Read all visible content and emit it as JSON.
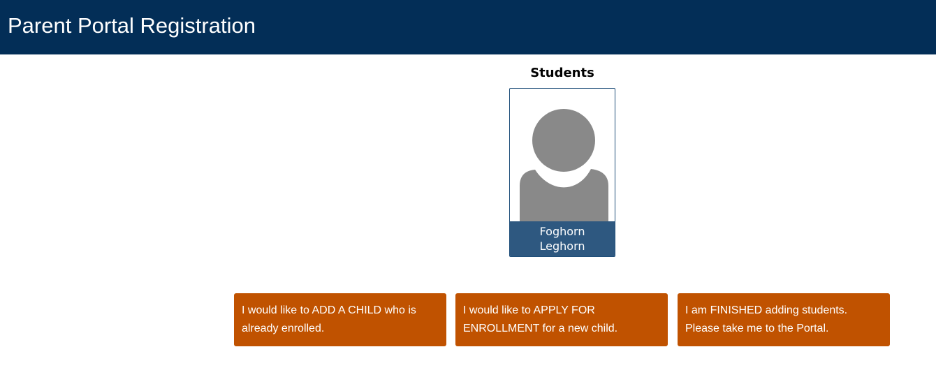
{
  "header": {
    "title": "Parent Portal Registration"
  },
  "students": {
    "heading": "Students",
    "items": [
      {
        "first_name": "Foghorn",
        "last_name": "Leghorn",
        "avatar_icon": "default-person-silhouette-icon"
      }
    ]
  },
  "actions": {
    "add_child": "I would like to ADD A CHILD who is already enrolled.",
    "apply_enrollment": "I would like to APPLY FOR ENROLLMENT for a new child.",
    "finished": "I am FINISHED adding students. Please take me to the Portal."
  },
  "colors": {
    "header_bg": "#032e57",
    "name_bar_bg": "#2e5880",
    "action_bg": "#c05200",
    "avatar_gray": "#898989"
  }
}
